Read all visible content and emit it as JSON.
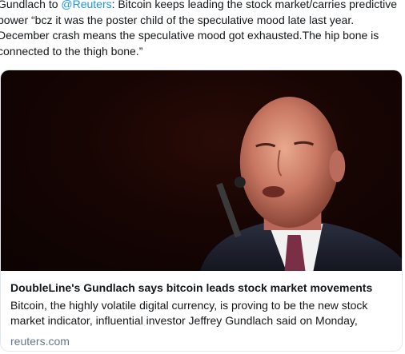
{
  "tweet": {
    "text_before_mention": "Gundlach to ",
    "mention": "@Reuters",
    "text_after_mention": ": Bitcoin keeps leading the stock market/carries predictive power “bcz it was the poster child of the speculative mood late last year. December crash means the speculative mood got exhausted.The hip bone is connected to the thigh bone.”"
  },
  "card": {
    "image_icon": "speaker-photo",
    "title": "DoubleLine's Gundlach says bitcoin leads stock market movements",
    "description": "Bitcoin, the highly volatile digital currency, is proving to be the new stock market indicator, influential investor Jeffrey Gundlach said on Monday,",
    "domain": "reuters.com"
  },
  "colors": {
    "link": "#1b95e0",
    "text": "#14171a",
    "secondary_text": "#657786",
    "card_border": "#e1e8ed"
  }
}
